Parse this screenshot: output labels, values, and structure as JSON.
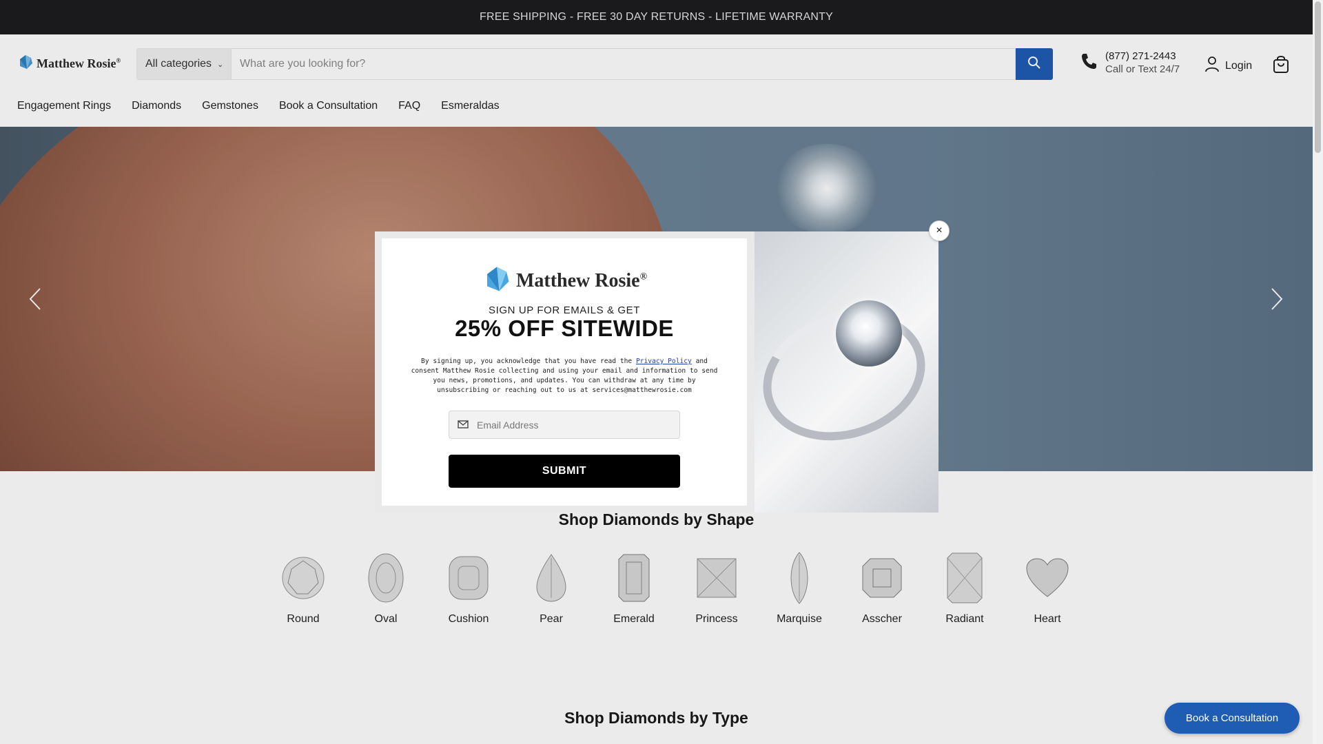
{
  "announcement": "FREE SHIPPING - FREE 30 DAY RETURNS - LIFETIME WARRANTY",
  "header": {
    "logo_text": "Matthew Rosie",
    "logo_reg": "®",
    "category_select": "All categories",
    "search_placeholder": "What are you looking for?",
    "phone": "(877) 271-2443",
    "phone_sub": "Call or Text 24/7",
    "login_label": "Login"
  },
  "nav": {
    "items": [
      {
        "label": "Engagement Rings"
      },
      {
        "label": "Diamonds"
      },
      {
        "label": "Gemstones"
      },
      {
        "label": "Book a Consultation"
      },
      {
        "label": "FAQ"
      },
      {
        "label": "Esmeraldas"
      }
    ]
  },
  "modal": {
    "logo_text": "Matthew Rosie",
    "logo_reg": "®",
    "subtitle": "SIGN UP FOR EMAILS & GET",
    "headline": "25% OFF SITEWIDE",
    "legal_pre": "By signing up, you acknowledge that you have read the ",
    "legal_link": "Privacy Policy",
    "legal_post": " and consent Matthew Rosie collecting and using your email and information to send you news, promotions, and updates. You can withdraw at any time by unsubscribing or reaching out to us at ",
    "legal_email": "services@matthewrosie.com",
    "email_placeholder": "Email Address",
    "submit_label": "SUBMIT",
    "close_symbol": "×"
  },
  "shapes_section": {
    "title": "Shop Diamonds by Shape",
    "items": [
      {
        "label": "Round"
      },
      {
        "label": "Oval"
      },
      {
        "label": "Cushion"
      },
      {
        "label": "Pear"
      },
      {
        "label": "Emerald"
      },
      {
        "label": "Princess"
      },
      {
        "label": "Marquise"
      },
      {
        "label": "Asscher"
      },
      {
        "label": "Radiant"
      },
      {
        "label": "Heart"
      }
    ]
  },
  "type_section": {
    "title": "Shop Diamonds by Type"
  },
  "floating_button": "Book a Consultation",
  "colors": {
    "accent_blue": "#1f5db5",
    "announcement_bg": "#1d1d1f",
    "submit_bg": "#000000"
  }
}
